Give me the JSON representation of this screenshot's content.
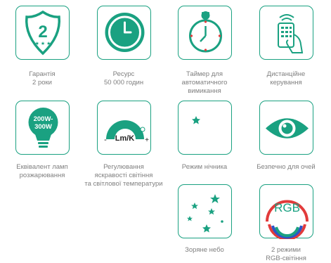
{
  "features": [
    {
      "id": "warranty",
      "lines": [
        "Гарантія",
        "2 роки"
      ],
      "icon": "shield-2-icon",
      "badge": "2"
    },
    {
      "id": "resource",
      "lines": [
        "Ресурс",
        "50 000 годин"
      ],
      "icon": "clock-icon"
    },
    {
      "id": "timer",
      "lines": [
        "Таймер для",
        "автоматичного",
        "вимикання"
      ],
      "icon": "stopwatch-icon"
    },
    {
      "id": "remote",
      "lines": [
        "Дистанційне",
        "керування"
      ],
      "icon": "remote-control-hand-icon"
    },
    {
      "id": "equivalent",
      "lines": [
        "Еквівалент ламп",
        "розжарювання"
      ],
      "icon": "bulb-icon",
      "bulb_text": [
        "200W-",
        "300W"
      ]
    },
    {
      "id": "brightness",
      "lines": [
        "Регулювання",
        "яскравості світіння",
        "та світлової температури"
      ],
      "icon": "dimmer-gauge-icon",
      "gauge_text": "Lm/K",
      "minus": "-",
      "plus": "+"
    },
    {
      "id": "night",
      "lines": [
        "Режим нічника"
      ],
      "icon": "moon-star-icon"
    },
    {
      "id": "eye",
      "lines": [
        "Безпечно для очей"
      ],
      "icon": "eye-icon"
    },
    {
      "id": "stars",
      "lines": [
        "Зоряне небо"
      ],
      "icon": "stars-icon"
    },
    {
      "id": "rgb",
      "lines": [
        "2 режими",
        "RGB-світіння"
      ],
      "icon": "rgb-rainbow-icon",
      "rgb_text": "RGB"
    }
  ],
  "colors": {
    "accent": "#1aa181",
    "caption": "#7f7f7f",
    "rgb_red": "#e23b3b",
    "rgb_blue": "#2c55c7",
    "rgb_green": "#1aa181"
  }
}
